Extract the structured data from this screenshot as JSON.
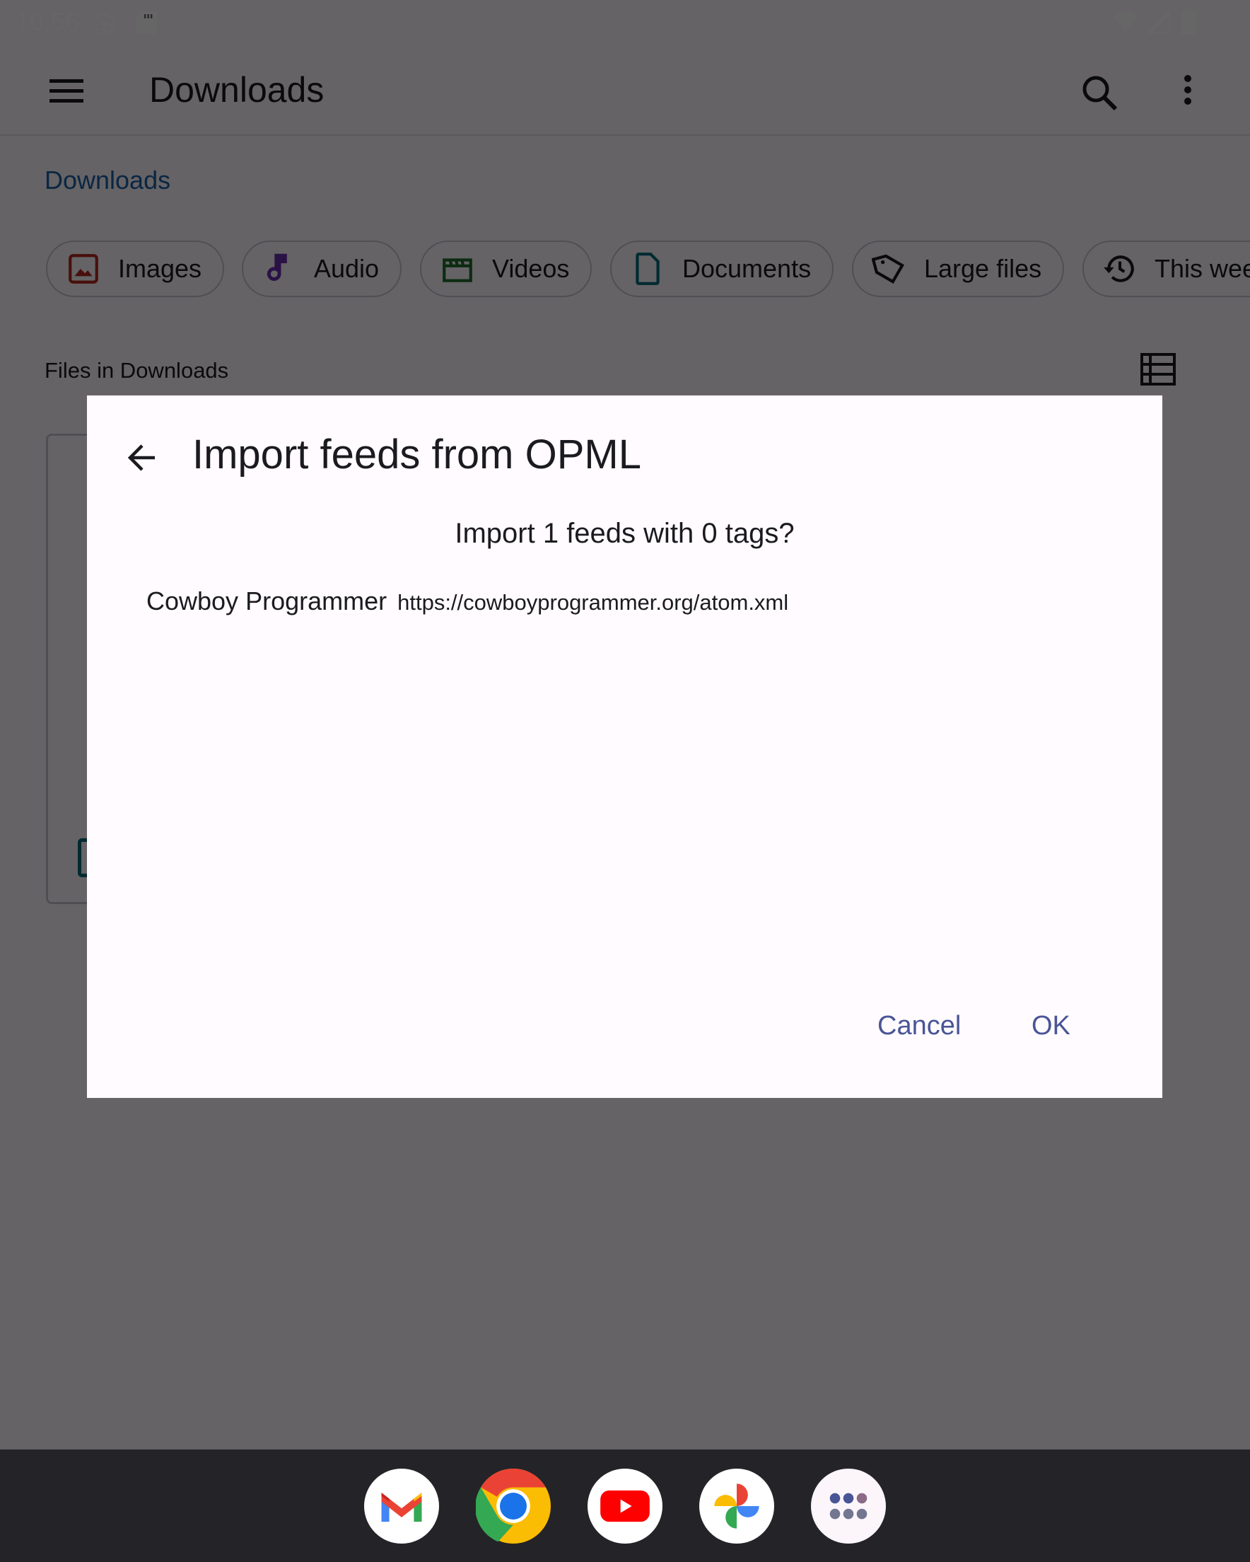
{
  "status_bar": {
    "time": "10:56",
    "icons": [
      "android-debug-icon",
      "sd-card-icon",
      "wifi-icon",
      "signal-icon",
      "battery-icon"
    ]
  },
  "app_bar": {
    "title": "Downloads",
    "menu_icon": "hamburger-menu-icon",
    "search_icon": "search-icon",
    "more_icon": "more-vert-icon"
  },
  "breadcrumb": "Downloads",
  "chips": [
    {
      "label": "Images",
      "icon": "image-icon",
      "color": "#b3261e"
    },
    {
      "label": "Audio",
      "icon": "music-note-icon",
      "color": "#6a2fb0"
    },
    {
      "label": "Videos",
      "icon": "clapperboard-icon",
      "color": "#1e6b2e"
    },
    {
      "label": "Documents",
      "icon": "document-icon",
      "color": "#006a7a"
    },
    {
      "label": "Large files",
      "icon": "tag-icon",
      "color": "#1b1b1f"
    },
    {
      "label": "This week",
      "icon": "history-icon",
      "color": "#1b1b1f"
    }
  ],
  "files_section": {
    "label": "Files in Downloads",
    "view_toggle_icon": "list-view-icon"
  },
  "dialog": {
    "title": "Import feeds from OPML",
    "back_icon": "arrow-back-icon",
    "question": "Import 1 feeds with 0 tags?",
    "feeds": [
      {
        "name": "Cowboy Programmer",
        "url": "https://cowboyprogrammer.org/atom.xml"
      }
    ],
    "buttons": {
      "cancel": "Cancel",
      "ok": "OK"
    },
    "accent_color": "#4a5596"
  },
  "dock": {
    "apps": [
      "Gmail",
      "Chrome",
      "YouTube",
      "Photos",
      "App drawer"
    ]
  }
}
